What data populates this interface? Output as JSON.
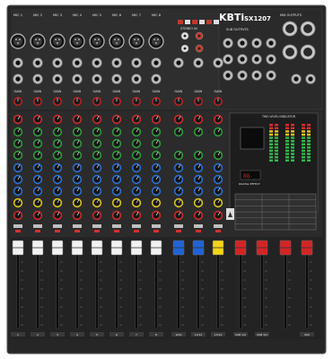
{
  "brand": {
    "logo": "KBTi",
    "model": "SX1207"
  },
  "top_labels": {
    "mic_inputs": [
      "MIC 1",
      "MIC 2",
      "MIC 3",
      "MIC 4",
      "MIC 5",
      "MIC 6",
      "MIC 7",
      "MIC 8"
    ],
    "stereo": "STEREO IN",
    "sub_outputs": "SUB OUTPUTS",
    "mix_outputs": "MIX OUTPUTS"
  },
  "gain_label": "GAIN",
  "display_panel": {
    "title": "TWO LEVEL INDICATOR",
    "digital_effect": "DIGITAL EFFECT"
  },
  "fader_caps": {
    "white": "#f2f2f2",
    "blue": "#1f63d6",
    "yellow": "#f4d51a",
    "red": "#d42424"
  },
  "bottom_labels": [
    "1",
    "2",
    "3",
    "4",
    "5",
    "6",
    "7",
    "8",
    "9/10",
    "11/12",
    "13/14",
    "SUB 1/2",
    "SUB 3/4",
    "",
    "MIX"
  ]
}
